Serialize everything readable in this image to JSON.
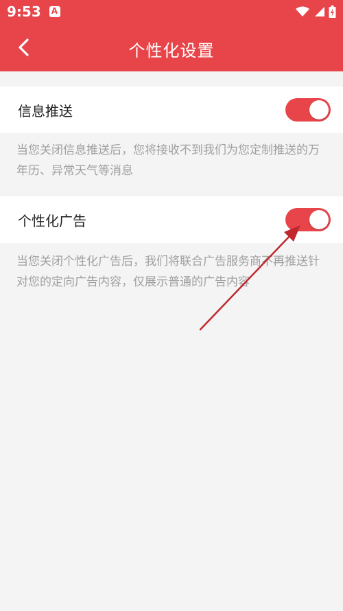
{
  "status_bar": {
    "time": "9:53",
    "app_icon": "app-notification-icon",
    "icons": [
      "wifi-icon",
      "cellular-signal-icon",
      "battery-icon"
    ]
  },
  "app_bar": {
    "title": "个性化设置",
    "back_icon": "chevron-left-icon"
  },
  "settings": [
    {
      "label": "信息推送",
      "enabled": true,
      "description": "当您关闭信息推送后，您将接收不到我们为您定制推送的万年历、异常天气等消息"
    },
    {
      "label": "个性化广告",
      "enabled": true,
      "description": "当您关闭个性化广告后，我们将联合广告服务商不再推送针对您的定向广告内容，仅展示普通的广告内容"
    }
  ],
  "colors": {
    "accent": "#e8454a",
    "annotation_arrow": "#c0282d",
    "background": "#f4f4f4",
    "description_text": "#a0a0a0"
  }
}
